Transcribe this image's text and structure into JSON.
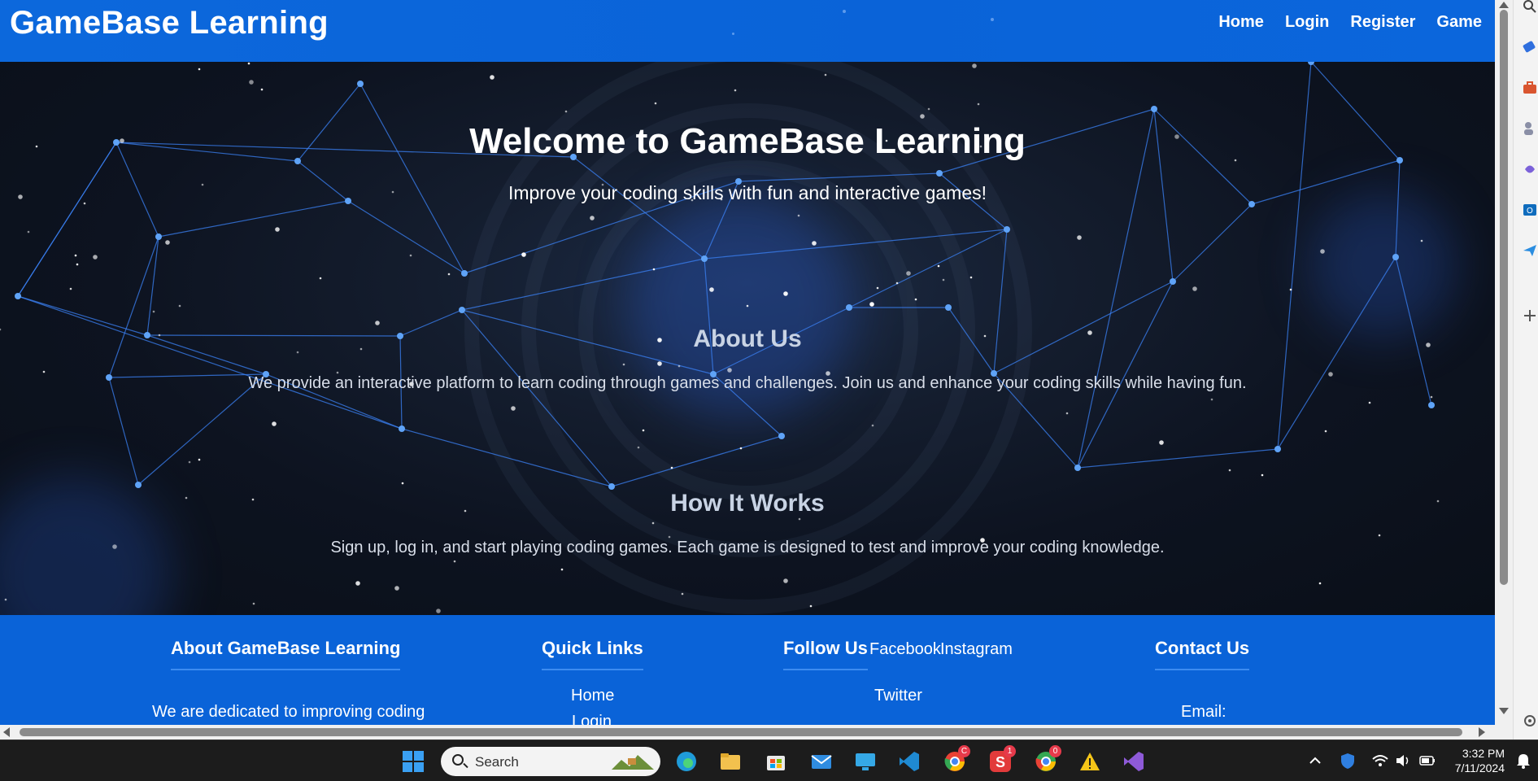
{
  "header": {
    "brand": "GameBase Learning",
    "nav": [
      "Home",
      "Login",
      "Register",
      "Game"
    ]
  },
  "hero": {
    "title": "Welcome to GameBase Learning",
    "subtitle": "Improve your coding skills with fun and interactive games!"
  },
  "about": {
    "title": "About Us",
    "text": "We provide an interactive platform to learn coding through games and challenges. Join us and enhance your coding skills while having fun."
  },
  "how": {
    "title": "How It Works",
    "text": "Sign up, log in, and start playing coding games. Each game is designed to test and improve your coding knowledge."
  },
  "footer": {
    "about_title": "About GameBase Learning",
    "about_text": "We are dedicated to improving coding",
    "quick_title": "Quick Links",
    "quick_links": [
      "Home",
      "Login"
    ],
    "follow_title": "Follow Us",
    "social": [
      "Facebook",
      "Instagram",
      "Twitter"
    ],
    "contact_title": "Contact Us",
    "contact_email_label": "Email:"
  },
  "taskbar": {
    "search_placeholder": "Search",
    "time": "3:32 PM",
    "date": "7/11/2024",
    "badges": [
      "C",
      "1",
      "0"
    ]
  },
  "colors": {
    "header_blue": "#0a63d8",
    "hero_dark": "#0d1320",
    "network_line": "#3b82f6"
  }
}
